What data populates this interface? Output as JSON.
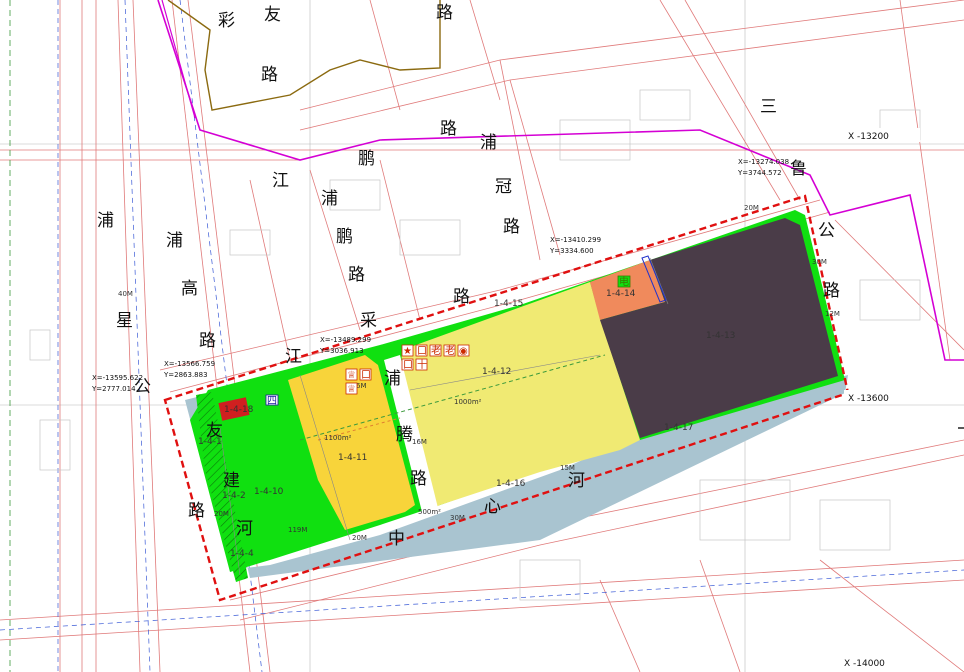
{
  "map": {
    "colors": {
      "background": "#ffffff",
      "road_line": "#e07a7a",
      "green_space": "#10e010",
      "residential": "#f0ea73",
      "residential_highlight": "#f8d43a",
      "commercial": "#f08a5c",
      "industrial": "#4a3c48",
      "water": "#a9c4d0",
      "boundary_red": "#e01010",
      "district_boundary": "#d400d4",
      "old_boundary": "#8b6a10"
    },
    "roads": [
      {
        "id": "caiyou-1",
        "text": "彩"
      },
      {
        "id": "caiyou-2",
        "text": "友"
      },
      {
        "id": "caiyou-3",
        "text": "路"
      },
      {
        "id": "road-lu-top",
        "text": "路"
      },
      {
        "id": "san-1",
        "text": "三"
      },
      {
        "id": "lu-north",
        "text": "鲁"
      },
      {
        "id": "jiangpeng-1",
        "text": "江"
      },
      {
        "id": "jiangpeng-2",
        "text": "鹏"
      },
      {
        "id": "jiangpeng-3",
        "text": "路"
      },
      {
        "id": "puguan-1",
        "text": "浦"
      },
      {
        "id": "puguan-2",
        "text": "冠"
      },
      {
        "id": "puguan-3",
        "text": "路"
      },
      {
        "id": "pugao-1",
        "text": "浦"
      },
      {
        "id": "pugao-2",
        "text": "高"
      },
      {
        "id": "pugao-3",
        "text": "路"
      },
      {
        "id": "puxing-1",
        "text": "浦"
      },
      {
        "id": "puxing-2",
        "text": "星"
      },
      {
        "id": "puxing-3",
        "text": "公"
      },
      {
        "id": "puxing-4",
        "text": "路"
      },
      {
        "id": "pupeng-1",
        "text": "浦"
      },
      {
        "id": "pupeng-2",
        "text": "鹏"
      },
      {
        "id": "pupeng-3",
        "text": "路"
      },
      {
        "id": "gonglu-1",
        "text": "公"
      },
      {
        "id": "gonglu-2",
        "text": "路"
      },
      {
        "id": "jiangcai-1",
        "text": "江"
      },
      {
        "id": "jiangcai-2",
        "text": "采"
      },
      {
        "id": "jiangcai-3",
        "text": "路"
      },
      {
        "id": "pudeng-1",
        "text": "浦"
      },
      {
        "id": "pudeng-2",
        "text": "腾"
      },
      {
        "id": "pudeng-3",
        "text": "路"
      },
      {
        "id": "youjian-1",
        "text": "友"
      },
      {
        "id": "youjian-2",
        "text": "建"
      },
      {
        "id": "youjian-3",
        "text": "河"
      },
      {
        "id": "zhongxin-1",
        "text": "中"
      },
      {
        "id": "zhongxin-2",
        "text": "心"
      },
      {
        "id": "zhongxin-3",
        "text": "河"
      }
    ],
    "parcels": [
      {
        "id": "1-4-15",
        "label": "1-4-15"
      },
      {
        "id": "1-4-14",
        "label": "1-4-14"
      },
      {
        "id": "1-4-13",
        "label": "1-4-13"
      },
      {
        "id": "1-4-12",
        "label": "1-4-12"
      },
      {
        "id": "1-4-11",
        "label": "1-4-11"
      },
      {
        "id": "1-4-10",
        "label": "1-4-10"
      },
      {
        "id": "1-4-16",
        "label": "1-4-16"
      },
      {
        "id": "1-4-17",
        "label": "1-4-17"
      },
      {
        "id": "1-4-18",
        "label": "1-4-18"
      },
      {
        "id": "1-4-1",
        "label": "1-4-1"
      },
      {
        "id": "1-4-2",
        "label": "1-4-2"
      },
      {
        "id": "1-4-4",
        "label": "1-4-4"
      }
    ],
    "coordinates": [
      {
        "id": "c1",
        "x": "X=-13274.038",
        "y": "Y=3744.572"
      },
      {
        "id": "c2",
        "x": "X=-13410.299",
        "y": "Y=3334.600"
      },
      {
        "id": "c3",
        "x": "X=-13489.299",
        "y": "Y=3036.913"
      },
      {
        "id": "c4",
        "x": "X=-13566.759",
        "y": "Y=2863.883"
      },
      {
        "id": "c5",
        "x": "X=-13595.622",
        "y": "Y=2777.014"
      }
    ],
    "grid_labels": [
      {
        "id": "g1",
        "text": "X  -13200"
      },
      {
        "id": "g2",
        "text": "X  -13600"
      },
      {
        "id": "g3",
        "text": "X  -14000"
      }
    ],
    "dimensions": [
      {
        "id": "d-40m",
        "text": "40M"
      },
      {
        "id": "d-16m",
        "text": "16M"
      },
      {
        "id": "d-1100",
        "text": "1100m²"
      },
      {
        "id": "d-1000",
        "text": "1000m²"
      },
      {
        "id": "d-500",
        "text": "500m²"
      },
      {
        "id": "d-119",
        "text": "119M"
      },
      {
        "id": "d-20m-a",
        "text": "20M"
      },
      {
        "id": "d-20m-b",
        "text": "20M"
      },
      {
        "id": "d-6m",
        "text": "6M"
      },
      {
        "id": "d-12m",
        "text": "12M"
      },
      {
        "id": "d-30m",
        "text": "30M"
      },
      {
        "id": "d-15m",
        "text": "15M"
      },
      {
        "id": "d-30m-b",
        "text": "30M"
      },
      {
        "id": "d-20m-c",
        "text": "20M"
      }
    ],
    "icons": [
      {
        "id": "i-star",
        "text": "★",
        "color": "#cc2a00"
      },
      {
        "id": "i-box",
        "text": "口",
        "color": "#cc2a00"
      },
      {
        "id": "i-old",
        "text": "老",
        "color": "#cc2a00"
      },
      {
        "id": "i-old2",
        "text": "老",
        "color": "#cc2a00"
      },
      {
        "id": "i-dot",
        "text": "◉",
        "color": "#cc2a00"
      },
      {
        "id": "i-box2",
        "text": "口",
        "color": "#cc2a00"
      },
      {
        "id": "i-plus",
        "text": "十",
        "color": "#cc2a00"
      },
      {
        "id": "i-cup",
        "text": "♕",
        "color": "#cc2a00"
      },
      {
        "id": "i-box3",
        "text": "口",
        "color": "#cc2a00"
      },
      {
        "id": "i-cup2",
        "text": "♕",
        "color": "#cc2a00"
      },
      {
        "id": "i-square",
        "text": "四",
        "color": "#1a1aa0"
      },
      {
        "id": "i-stair",
        "text": "电",
        "color": "#3a7a00"
      }
    ]
  }
}
